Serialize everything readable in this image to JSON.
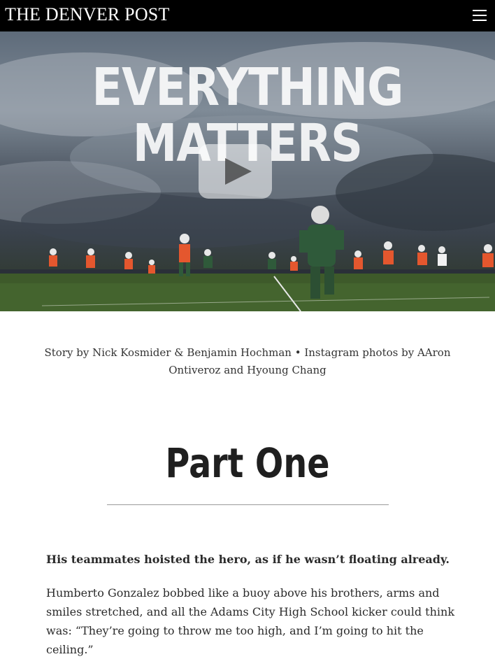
{
  "header": {
    "masthead": "THE DENVER POST",
    "menu_icon": "hamburger-menu-icon"
  },
  "hero": {
    "title": "EVERYTHING MATTERS",
    "play_icon": "play-icon"
  },
  "article": {
    "byline": "Story by Nick Kosmider & Benjamin Hochman • Instagram photos by AAron Ontiveroz and Hyoung Chang",
    "section_title": "Part One",
    "lead": "His teammates hoisted the hero, as if he wasn’t floating already.",
    "paragraph": "Humberto Gonzalez bobbed like a buoy above his brothers, arms and smiles stretched, and all the Adams City High School kicker could think was: “They’re going to throw me too high, and I’m going to hit the ceiling.”"
  },
  "colors": {
    "topbar": "#000000",
    "jersey_orange": "#e4572e",
    "jersey_green": "#2f5a3a",
    "field_green": "#3e5a2a"
  }
}
